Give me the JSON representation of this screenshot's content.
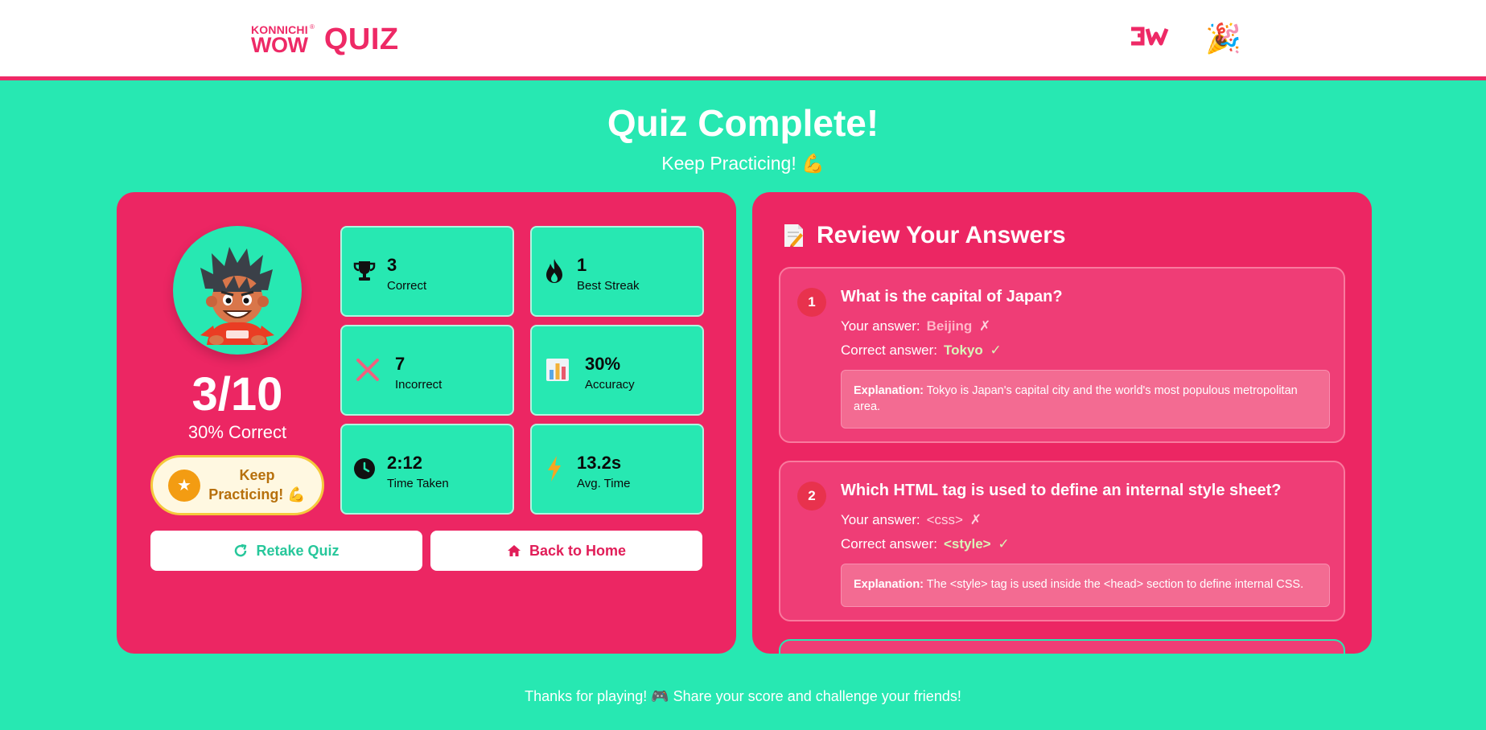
{
  "header": {
    "logo_top": "KONNICHI",
    "logo_bottom": "WOW",
    "logo_mark": "®",
    "quiz_label": "QUIZ",
    "dw_logo_icon": "dw-logo-icon",
    "party_icon": "🎉"
  },
  "hero": {
    "title": "Quiz Complete!",
    "subtitle": "Keep Practicing! 💪"
  },
  "summary": {
    "score": "3/10",
    "percent": "30% Correct",
    "badge": "Keep Practicing! 💪",
    "badge_icon": "star-icon"
  },
  "stats": [
    {
      "value": "3",
      "label": "Correct",
      "icon": "trophy-icon"
    },
    {
      "value": "1",
      "label": "Best Streak",
      "icon": "flame-icon"
    },
    {
      "value": "7",
      "label": "Incorrect",
      "icon": "cross-icon"
    },
    {
      "value": "30%",
      "label": "Accuracy",
      "icon": "bar-chart-icon"
    },
    {
      "value": "2:12",
      "label": "Time Taken",
      "icon": "clock-icon"
    },
    {
      "value": "13.2s",
      "label": "Avg. Time",
      "icon": "lightning-icon"
    }
  ],
  "buttons": {
    "retake": "Retake Quiz",
    "home": "Back to Home"
  },
  "review": {
    "title": "Review Your Answers",
    "icon": "memo-icon",
    "questions": [
      {
        "num": "1",
        "question": "What is the capital of Japan?",
        "your_label": "Your answer:",
        "your_answer": "Beijing",
        "your_mark": "✗",
        "correct_label": "Correct answer:",
        "correct_answer": "Tokyo",
        "correct_mark": "✓",
        "explanation_label": "Explanation:",
        "explanation": "Tokyo is Japan's capital city and the world's most populous metropolitan area."
      },
      {
        "num": "2",
        "question": "Which HTML tag is used to define an internal style sheet?",
        "your_label": "Your answer:",
        "your_answer": "<css>",
        "your_mark": "✗",
        "correct_label": "Correct answer:",
        "correct_answer": "<style>",
        "correct_mark": "✓",
        "explanation_label": "Explanation:",
        "explanation": "The <style> tag is used inside the <head> section to define internal CSS."
      }
    ]
  },
  "footer": "Thanks for playing! 🎮 Share your score and challenge your friends!",
  "colors": {
    "accent_pink": "#ec2663",
    "accent_mint": "#27e8b2",
    "badge_bg": "#fff8e1"
  }
}
